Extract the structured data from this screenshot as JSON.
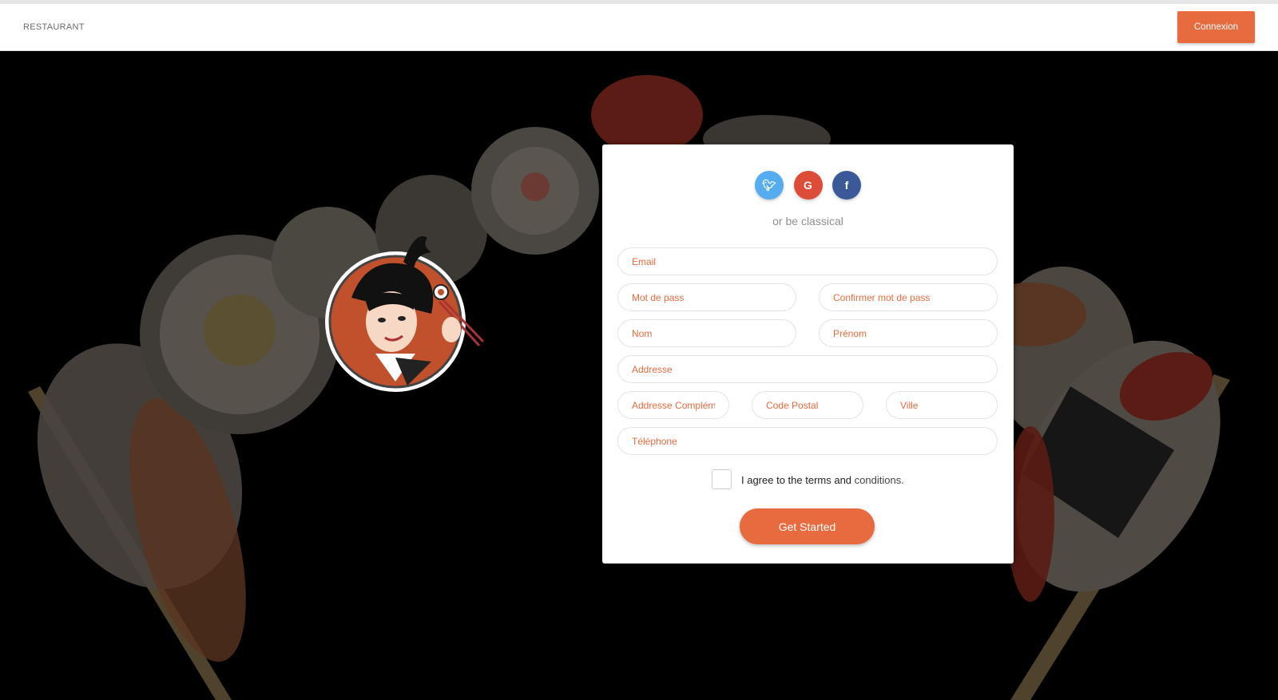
{
  "navbar": {
    "brand": "RESTAURANT",
    "login_label": "Connexion"
  },
  "socials": [
    {
      "name": "twitter-icon",
      "glyph": "𝕥",
      "color": "#55acee"
    },
    {
      "name": "google-icon",
      "glyph": "G",
      "color": "#dd4b39"
    },
    {
      "name": "facebook-icon",
      "glyph": "f",
      "color": "#3b5998"
    }
  ],
  "form": {
    "subtitle": "or be classical",
    "email_ph": "Email",
    "password_ph": "Mot de pass",
    "confirm_ph": "Confirmer mot de pass",
    "nom_ph": "Nom",
    "prenom_ph": "Prénom",
    "address_ph": "Addresse",
    "address2_ph": "Addresse Complément",
    "postal_ph": "Code Postal",
    "city_ph": "Ville",
    "phone_ph": "Téléphone",
    "agree_prefix": "I agree to the terms and",
    "agree_link": "conditions.",
    "submit_label": "Get Started"
  },
  "colors": {
    "accent": "#e86b3f",
    "background": "#000000",
    "card": "#ffffff"
  }
}
